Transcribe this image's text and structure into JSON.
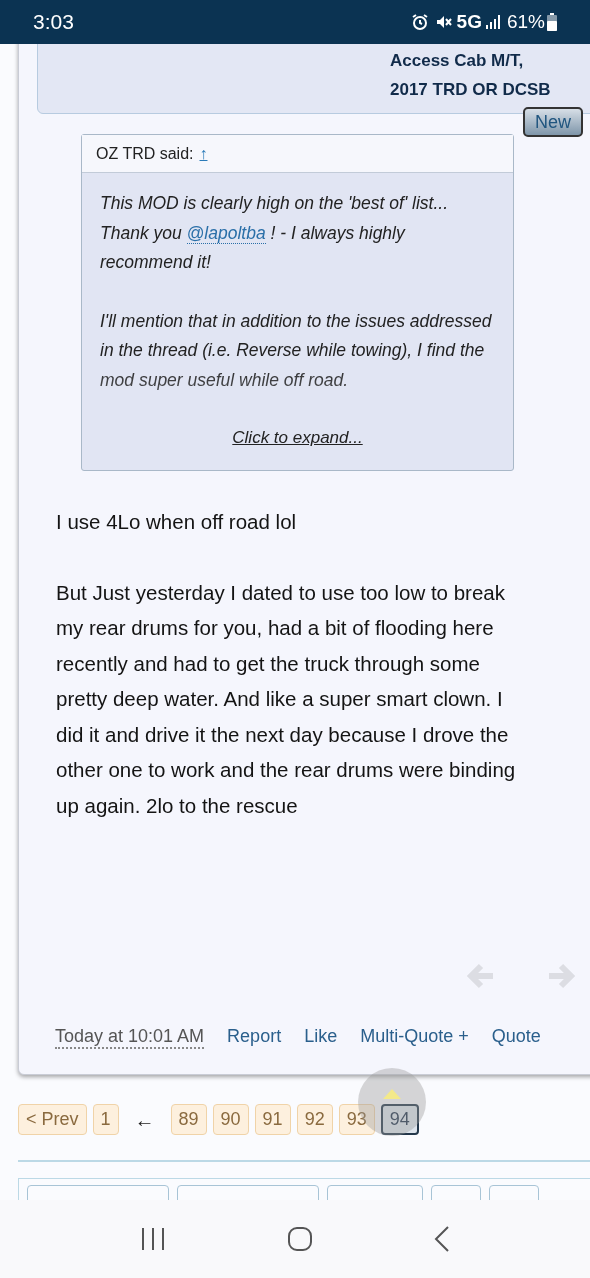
{
  "status_bar": {
    "time": "3:03",
    "network": "5G",
    "battery": "61%"
  },
  "author_info": {
    "vehicle_lines": [
      "Access Cab M/T,",
      "2017 TRD OR DCSB"
    ],
    "new_badge": "New"
  },
  "quote": {
    "author": "OZ TRD said:",
    "jump_icon": "↑",
    "paragraphs": [
      {
        "before": "This MOD is clearly high on the 'best of' list... Thank you ",
        "mention": "@lapoltba",
        "after": " ! - I always highly recommend it!"
      },
      {
        "before": "I'll mention that in addition to the issues addressed in the thread (i.e. Reverse while towing), I find the mod super useful while off road."
      }
    ],
    "expand": "Click to expand..."
  },
  "body": [
    "I use 4Lo when off road lol",
    "But Just yesterday I dated to use too low to break my rear drums for you, had a bit of flooding here recently and had to get the truck through some pretty deep water. And like a super smart clown. I did it and drive it the next day because I drove the other one to work and the rear drums were binding up again. 2lo to the rescue"
  ],
  "footer": {
    "time": "Today at 10:01 AM",
    "actions": [
      "Report",
      "Like",
      "Multi-Quote +",
      "Quote"
    ]
  },
  "pagination": [
    {
      "label": "< Prev",
      "kind": "page",
      "selected": false
    },
    {
      "label": "1",
      "kind": "page",
      "selected": false
    },
    {
      "label": "←",
      "kind": "jump"
    },
    {
      "label": "89",
      "kind": "page",
      "selected": false
    },
    {
      "label": "90",
      "kind": "page",
      "selected": false
    },
    {
      "label": "91",
      "kind": "page",
      "selected": false
    },
    {
      "label": "92",
      "kind": "page",
      "selected": false
    },
    {
      "label": "93",
      "kind": "page",
      "selected": false
    },
    {
      "label": "94",
      "kind": "page",
      "selected": true
    }
  ]
}
